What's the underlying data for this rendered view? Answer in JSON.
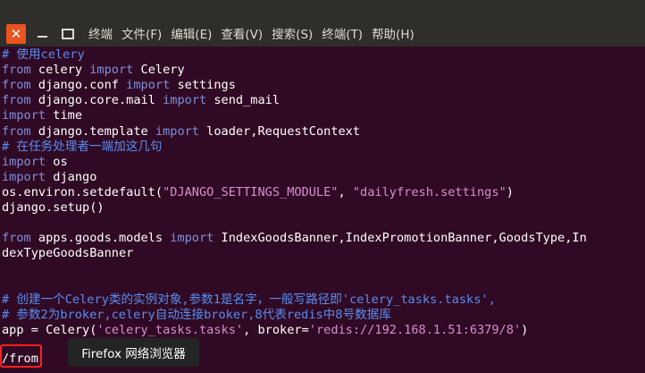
{
  "window": {
    "close_glyph": "✕",
    "icons": [
      "close-icon",
      "minimize-icon",
      "maximize-icon"
    ]
  },
  "menu": [
    "终端",
    "文件(F)",
    "编辑(E)",
    "查看(V)",
    "搜索(S)",
    "终端(T)",
    "帮助(H)"
  ],
  "lines": [
    [
      {
        "t": "# 使用celery",
        "c": "c"
      }
    ],
    [
      {
        "t": "from",
        "c": "k"
      },
      {
        "t": " celery ",
        "c": "t"
      },
      {
        "t": "import",
        "c": "k"
      },
      {
        "t": " Celery",
        "c": "t"
      }
    ],
    [
      {
        "t": "from",
        "c": "k"
      },
      {
        "t": " django.conf ",
        "c": "t"
      },
      {
        "t": "import",
        "c": "k"
      },
      {
        "t": " settings",
        "c": "t"
      }
    ],
    [
      {
        "t": "from",
        "c": "k"
      },
      {
        "t": " django.core.mail ",
        "c": "t"
      },
      {
        "t": "import",
        "c": "k"
      },
      {
        "t": " send_mail",
        "c": "t"
      }
    ],
    [
      {
        "t": "import",
        "c": "k"
      },
      {
        "t": " time",
        "c": "t"
      }
    ],
    [
      {
        "t": "from",
        "c": "k"
      },
      {
        "t": " django.template ",
        "c": "t"
      },
      {
        "t": "import",
        "c": "k"
      },
      {
        "t": " loader,RequestContext",
        "c": "t"
      }
    ],
    [
      {
        "t": "# 在任务处理者一端加这几句",
        "c": "c"
      }
    ],
    [
      {
        "t": "import",
        "c": "k"
      },
      {
        "t": " os",
        "c": "t"
      }
    ],
    [
      {
        "t": "import",
        "c": "k"
      },
      {
        "t": " django",
        "c": "t"
      }
    ],
    [
      {
        "t": "os.environ.setdefault(",
        "c": "t"
      },
      {
        "t": "\"DJANGO_SETTINGS_MODULE\"",
        "c": "s"
      },
      {
        "t": ", ",
        "c": "t"
      },
      {
        "t": "\"dailyfresh.settings\"",
        "c": "s"
      },
      {
        "t": ")",
        "c": "t"
      }
    ],
    [
      {
        "t": "django.setup()",
        "c": "t"
      }
    ],
    [],
    [
      {
        "t": "from",
        "c": "k"
      },
      {
        "t": " apps.goods.models ",
        "c": "t"
      },
      {
        "t": "import",
        "c": "k"
      },
      {
        "t": " IndexGoodsBanner,IndexPromotionBanner,GoodsType,In",
        "c": "t"
      }
    ],
    [
      {
        "t": "dexTypeGoodsBanner",
        "c": "t"
      }
    ],
    [],
    [],
    [
      {
        "t": "# 创建一个Celery类的实例对象,参数1是名字，一般写路径即'celery_tasks.tasks',",
        "c": "c"
      }
    ],
    [
      {
        "t": "# 参数2为broker,celery自动连接broker,8代表redis中8号数据库",
        "c": "c"
      }
    ],
    [
      {
        "t": "app = Celery(",
        "c": "t"
      },
      {
        "t": "'celery_tasks.tasks'",
        "c": "s"
      },
      {
        "t": ", broker=",
        "c": "t"
      },
      {
        "t": "'redis://192.168.1.51:6379/8'",
        "c": "s"
      },
      {
        "t": ")",
        "c": "t"
      }
    ]
  ],
  "search": {
    "text": "/from"
  },
  "tooltip": {
    "text": "Firefox 网络浏览器"
  }
}
